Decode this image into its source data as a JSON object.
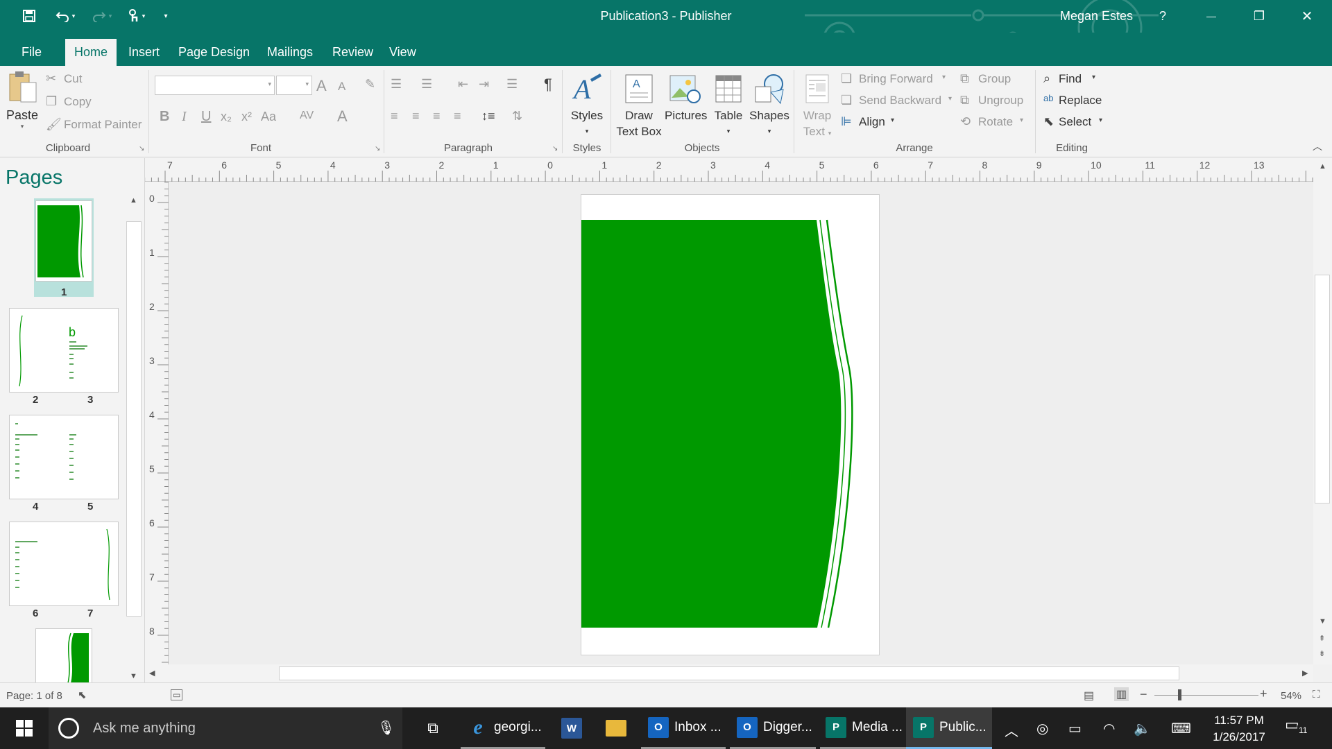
{
  "window": {
    "app_title": "Publication3  -  Publisher",
    "user_name": "Megan Estes",
    "help": "?",
    "minimize": "—",
    "restore": "❐",
    "close": "✕"
  },
  "quick_access": {
    "save_icon": "save-icon",
    "undo_icon": "undo-icon",
    "redo_icon": "redo-icon",
    "touch_icon": "touch-mode-icon"
  },
  "tabs": [
    {
      "label": "File",
      "active": false
    },
    {
      "label": "Home",
      "active": true
    },
    {
      "label": "Insert",
      "active": false
    },
    {
      "label": "Page Design",
      "active": false
    },
    {
      "label": "Mailings",
      "active": false
    },
    {
      "label": "Review",
      "active": false
    },
    {
      "label": "View",
      "active": false
    }
  ],
  "ribbon": {
    "clipboard": {
      "group_label": "Clipboard",
      "paste": "Paste",
      "cut": "Cut",
      "copy": "Copy",
      "format_painter": "Format Painter"
    },
    "font": {
      "group_label": "Font",
      "font_name": "",
      "font_size": "",
      "bold": "B",
      "italic": "I",
      "underline": "U",
      "subscript": "x₂",
      "superscript": "x²",
      "change_case": "Aa",
      "spacing": "AV",
      "font_color": "A",
      "grow": "A",
      "shrink": "A"
    },
    "paragraph": {
      "group_label": "Paragraph",
      "pilcrow": "¶"
    },
    "styles": {
      "group_label": "Styles",
      "styles": "Styles"
    },
    "objects": {
      "group_label": "Objects",
      "draw_text_box_line1": "Draw",
      "draw_text_box_line2": "Text Box",
      "pictures": "Pictures",
      "table": "Table",
      "shapes": "Shapes"
    },
    "arrange": {
      "group_label": "Arrange",
      "wrap_text_line1": "Wrap",
      "wrap_text_line2": "Text",
      "bring_forward": "Bring Forward",
      "send_backward": "Send Backward",
      "align": "Align",
      "group": "Group",
      "ungroup": "Ungroup",
      "rotate": "Rotate"
    },
    "editing": {
      "group_label": "Editing",
      "find": "Find",
      "replace": "Replace",
      "select": "Select"
    }
  },
  "pages_pane": {
    "title": "Pages",
    "page_labels": [
      "1",
      "2",
      "3",
      "4",
      "5",
      "6",
      "7"
    ]
  },
  "rulers": {
    "horizontal": [
      "7",
      "6",
      "5",
      "4",
      "3",
      "2",
      "1",
      "0",
      "1",
      "2",
      "3",
      "4",
      "5",
      "6",
      "7",
      "8",
      "9",
      "10",
      "11",
      "12",
      "13"
    ],
    "vertical": [
      "0",
      "1",
      "2",
      "3",
      "4",
      "5",
      "6",
      "7",
      "8"
    ]
  },
  "colors": {
    "accent": "#077568",
    "page_green": "#009900"
  },
  "statusbar": {
    "page_info": "Page: 1 of 8",
    "zoom": "54%"
  },
  "taskbar": {
    "search_placeholder": "Ask me anything",
    "apps": [
      {
        "label": "georgi...",
        "icon": "edge-icon"
      },
      {
        "label": "",
        "icon": "word-icon"
      },
      {
        "label": "",
        "icon": "file-explorer-icon"
      },
      {
        "label": "Inbox ...",
        "icon": "outlook-icon"
      },
      {
        "label": "Digger...",
        "icon": "outlook-icon"
      },
      {
        "label": "Media ...",
        "icon": "publisher-icon"
      },
      {
        "label": "Public...",
        "icon": "publisher-icon"
      }
    ],
    "time": "11:57 PM",
    "date": "1/26/2017",
    "notifications": "11"
  }
}
